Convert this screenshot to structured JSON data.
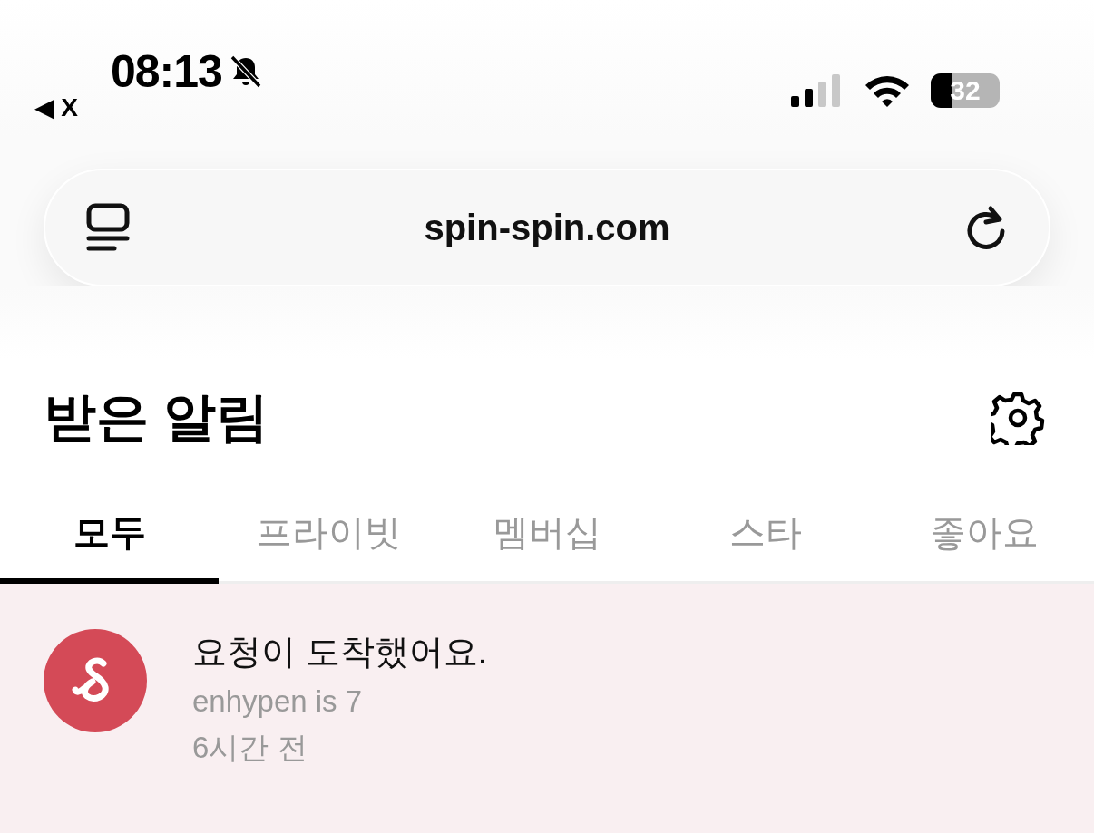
{
  "status_bar": {
    "time": "08:13",
    "back_label": "◀ X",
    "battery": "32",
    "muted": true
  },
  "address_bar": {
    "url": "spin-spin.com"
  },
  "header": {
    "title": "받은 알림"
  },
  "tabs": [
    {
      "label": "모두",
      "selected": true
    },
    {
      "label": "프라이빗",
      "selected": false
    },
    {
      "label": "멤버십",
      "selected": false
    },
    {
      "label": "스타",
      "selected": false
    },
    {
      "label": "좋아요",
      "selected": false
    }
  ],
  "notifications": [
    {
      "title": "요청이 도착했어요.",
      "subtitle": "enhypen is 7",
      "time": "6시간 전",
      "unread": true
    }
  ]
}
